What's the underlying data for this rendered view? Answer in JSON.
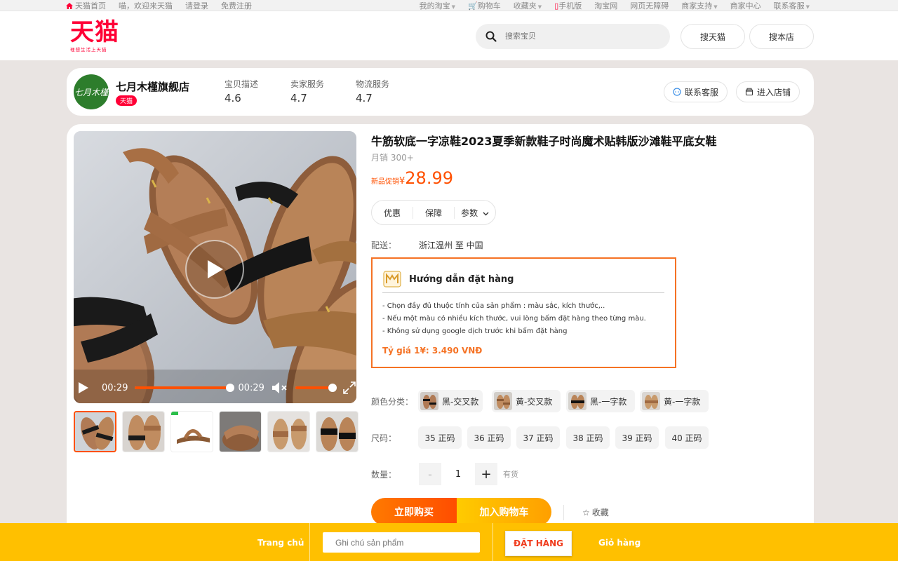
{
  "topbar": {
    "home_label": "天猫首页",
    "welcome": "喵，欢迎来天猫",
    "login": "请登录",
    "register": "免费注册",
    "my_taobao": "我的淘宝",
    "cart": "购物车",
    "favorites": "收藏夹",
    "mobile": "手机版",
    "taobao": "淘宝网",
    "accessibility": "网页无障碍",
    "merchant_support": "商家支持",
    "merchant_center": "商家中心",
    "contact": "联系客服"
  },
  "header": {
    "logo": "天猫",
    "slogan": "理想生活上天猫",
    "search_placeholder": "搜索宝贝",
    "search_tmall": "搜天猫",
    "search_store": "搜本店"
  },
  "store": {
    "avatar_text": "七月木槿",
    "name": "七月木槿旗舰店",
    "tag": "天猫",
    "scores": [
      {
        "label": "宝贝描述",
        "value": "4.6"
      },
      {
        "label": "卖家服务",
        "value": "4.7"
      },
      {
        "label": "物流服务",
        "value": "4.7"
      }
    ],
    "contact_service": "联系客服",
    "enter_store": "进入店铺"
  },
  "video": {
    "current_time": "00:29",
    "duration": "00:29",
    "progress": 1.0,
    "volume": 0.9
  },
  "product": {
    "title": "牛筋软底一字凉鞋2023夏季新款鞋子时尚魔术贴韩版沙滩鞋平底女鞋",
    "sales": "月销 300+",
    "price_label": "新品促销",
    "currency": "¥",
    "price": "28.99",
    "tabs": [
      "优惠",
      "保障",
      "参数"
    ],
    "ship_label": "配送：",
    "ship_value": "浙江温州 至 中国"
  },
  "guide": {
    "title": "Hướng dẫn đặt hàng",
    "items": [
      "- Chọn đầy đủ thuộc tính của sản phẩm : màu sắc, kích thước,..",
      "- Nếu một màu có nhiều kích thước, vui lòng bấm đặt hàng theo từng màu.",
      "- Không sử dụng google dịch trước khi bấm đặt hàng"
    ],
    "rate": "Tỷ giá 1¥: 3.490 VNĐ"
  },
  "options": {
    "color_label": "颜色分类：",
    "colors": [
      "黑-交叉款",
      "黄-交叉款",
      "黑-一字款",
      "黄-一字款"
    ],
    "size_label": "尺码：",
    "sizes": [
      "35 正码",
      "36 正码",
      "37 正码",
      "38 正码",
      "39 正码",
      "40 正码"
    ],
    "qty_label": "数量：",
    "qty_minus": "-",
    "qty_value": "1",
    "qty_plus": "+",
    "stock": "有货"
  },
  "actions": {
    "buy_now": "立即购买",
    "add_to_cart": "加入购物车",
    "favorite": "收藏"
  },
  "bottombar": {
    "home": "Trang chủ",
    "note_placeholder": "Ghi chú sản phẩm",
    "order": "ĐẶT HÀNG",
    "cart": "Giỏ hàng"
  },
  "colors": {
    "tmall_red": "#ff0036",
    "price_orange": "#ff5000",
    "guide_border": "#f57224",
    "bottom_bar": "#ffc000"
  }
}
